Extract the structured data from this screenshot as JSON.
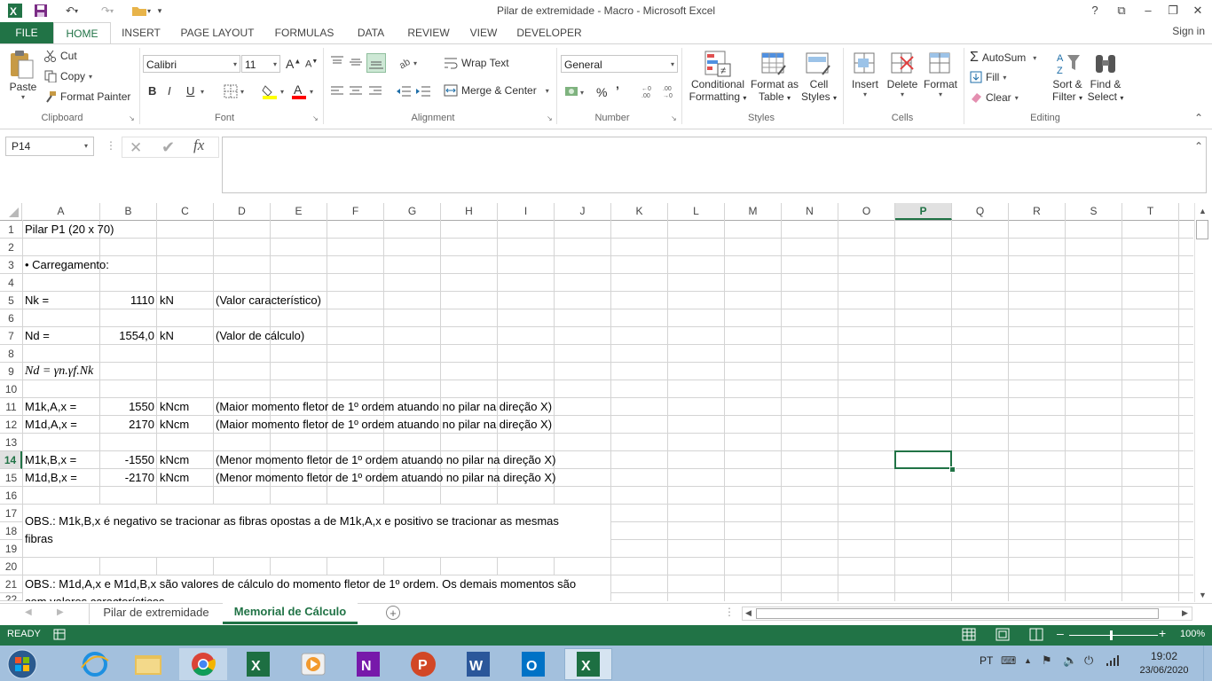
{
  "window": {
    "title": "Pilar de extremidade - Macro - Microsoft Excel",
    "help": "?",
    "restore_ribbon": "⧉",
    "minimize": "–",
    "restore": "❐",
    "close": "✕"
  },
  "tabs": {
    "file": "FILE",
    "items": [
      "HOME",
      "INSERT",
      "PAGE LAYOUT",
      "FORMULAS",
      "DATA",
      "REVIEW",
      "VIEW",
      "DEVELOPER"
    ],
    "active": "HOME",
    "signin": "Sign in"
  },
  "ribbon": {
    "clipboard": {
      "label": "Clipboard",
      "paste": "Paste",
      "cut": "Cut",
      "copy": "Copy",
      "format_painter": "Format Painter"
    },
    "font": {
      "label": "Font",
      "name": "Calibri",
      "size": "11",
      "bold": "B",
      "italic": "I",
      "underline": "U",
      "grow": "A",
      "shrink": "A",
      "font_color_hex": "#ff0000",
      "fill_color_hex": "#ffff00"
    },
    "alignment": {
      "label": "Alignment",
      "wrap_text": "Wrap Text",
      "merge_center": "Merge & Center"
    },
    "number": {
      "label": "Number",
      "format": "General",
      "percent": "%",
      "comma": "’"
    },
    "styles": {
      "label": "Styles",
      "conditional_1": "Conditional",
      "conditional_2": "Formatting",
      "format_table_1": "Format as",
      "format_table_2": "Table",
      "cell_styles_1": "Cell",
      "cell_styles_2": "Styles"
    },
    "cells": {
      "label": "Cells",
      "insert": "Insert",
      "delete": "Delete",
      "format": "Format"
    },
    "editing": {
      "label": "Editing",
      "autosum": "AutoSum",
      "fill": "Fill",
      "clear": "Clear",
      "sort_1": "Sort &",
      "sort_2": "Filter",
      "find_1": "Find &",
      "find_2": "Select"
    }
  },
  "formula_bar": {
    "name_box": "P14",
    "fx": "fx",
    "value": ""
  },
  "columns": [
    "A",
    "B",
    "C",
    "D",
    "E",
    "F",
    "G",
    "H",
    "I",
    "J",
    "K",
    "L",
    "M",
    "N",
    "O",
    "P",
    "Q",
    "R",
    "S",
    "T"
  ],
  "selected_column": "P",
  "selected_row": "14",
  "rows": [
    "1",
    "2",
    "3",
    "4",
    "5",
    "6",
    "7",
    "8",
    "9",
    "10",
    "11",
    "12",
    "13",
    "14",
    "15",
    "16",
    "17",
    "18",
    "19",
    "20",
    "21",
    "22"
  ],
  "cells": {
    "a1": "Pilar P1 (20 x 70)",
    "a3": "• Carregamento:",
    "a5": "Nk =",
    "b5": "1110",
    "c5": "kN",
    "d5": "(Valor característico)",
    "a7": "Nd =",
    "b7": "1554,0",
    "c7": "kN",
    "d7": "(Valor de cálculo)",
    "a9": "Nd = γn.γf.Nk",
    "a11": "M1k,A,x =",
    "b11": "1550",
    "c11": "kNcm",
    "d11": "(Maior momento fletor de 1º ordem atuando no pilar na direção X)",
    "a12": "M1d,A,x =",
    "b12": "2170",
    "c12": "kNcm",
    "d12": "(Maior momento fletor de 1º ordem atuando no pilar na direção X)",
    "a14": "M1k,B,x =",
    "b14": "-1550",
    "c14": "kNcm",
    "d14": "(Menor momento fletor de 1º ordem atuando no pilar na direção X)",
    "a15": "M1d,B,x =",
    "b15": "-2170",
    "c15": "kNcm",
    "d15": "(Menor momento fletor de 1º ordem atuando no pilar na direção X)",
    "a17_line1": "OBS.:  M1k,B,x é negativo se tracionar as fibras opostas a de M1k,A,x e positivo se tracionar as mesmas",
    "a17_line2": "fibras",
    "a21_line1": "OBS.: M1d,A,x e M1d,B,x são valores de cálculo do momento fletor de 1º ordem. Os demais momentos são",
    "a21_line2": "com valores característicos."
  },
  "sheets": {
    "items": [
      "Pilar de extremidade",
      "Memorial de Cálculo"
    ],
    "active": "Memorial de Cálculo",
    "add": "+"
  },
  "status": {
    "ready": "READY",
    "zoom": "100%",
    "zoom_minus": "–",
    "zoom_plus": "+"
  },
  "taskbar": {
    "lang": "PT",
    "time": "19:02",
    "date": "23/06/2020"
  },
  "colors": {
    "excel_green": "#217346",
    "taskbar": "#a3c0dd"
  }
}
